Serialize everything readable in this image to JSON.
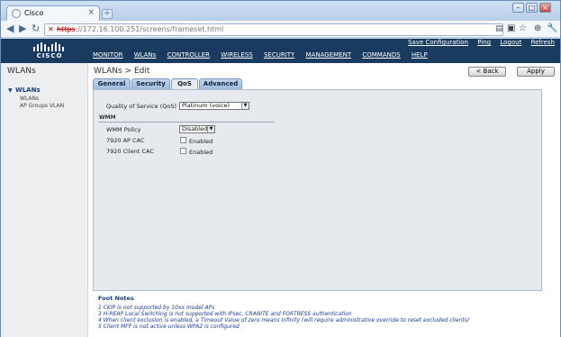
{
  "browser": {
    "tab_title": "Cisco",
    "tab_close": "×",
    "new_tab": "+",
    "url_scheme": "https",
    "url_rest": "://172.16.100.251/screens/frameset.html",
    "icons": [
      "back-icon",
      "forward-icon",
      "reload-icon",
      "page-icon",
      "star-icon",
      "tools-icon"
    ]
  },
  "header": {
    "logo_text": "CISCO",
    "top_links": [
      "Save Configuration",
      "Ping",
      "Logout",
      "Refresh"
    ],
    "menu": [
      "MONITOR",
      "WLANs",
      "CONTROLLER",
      "WIRELESS",
      "SECURITY",
      "MANAGEMENT",
      "COMMANDS",
      "HELP"
    ]
  },
  "sidebar": {
    "title": "WLANs",
    "section": "WLANs",
    "items": [
      "WLANs",
      "AP Groups VLAN"
    ]
  },
  "main": {
    "title": "WLANs > Edit",
    "back_button": "< Back",
    "apply_button": "Apply",
    "tabs": [
      "General",
      "Security",
      "QoS",
      "Advanced"
    ],
    "active_tab": "QoS",
    "qos_label": "Quality of Service (QoS)",
    "qos_value": "Platinum (voice)",
    "wmm_section": "WMM",
    "wmm_policy_label": "WMM Policy",
    "wmm_policy_value": "Disabled",
    "ap_cac_label": "7920 AP CAC",
    "ap_cac_value": "Enabled",
    "client_cac_label": "7920 Client CAC",
    "client_cac_value": "Enabled"
  },
  "footnotes": {
    "title": "Foot Notes",
    "lines": [
      "1 CKIP is not supported by 10xx model APs",
      "3 H-REAP Local Switching is not supported with IPsec, CRANITE and FORTRESS authentication",
      "4 When client exclusion is enabled, a Timeout Value of zero means infinity (will require administrative override to reset excluded clients)",
      "5 Client MFP is not active unless WPA2 is configured"
    ]
  }
}
